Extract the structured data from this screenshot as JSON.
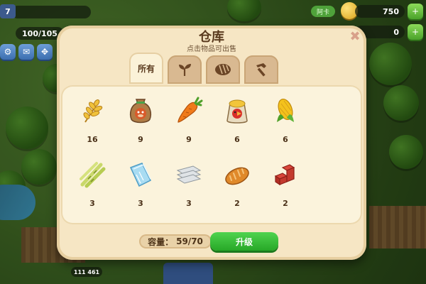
{
  "hud": {
    "level": "7",
    "xp": "100/105",
    "coins": "750",
    "premium": "0",
    "ribbon_label": "阿卡",
    "bottom_hint": "111 461"
  },
  "dialog": {
    "title": "仓库",
    "subtitle": "点击物品可出售",
    "close_symbol": "✖",
    "tabs": [
      {
        "id": "all",
        "label": "所有",
        "icon": "",
        "active": true
      },
      {
        "id": "crops",
        "label": "",
        "icon": "sprout-icon"
      },
      {
        "id": "products",
        "label": "",
        "icon": "bread-icon"
      },
      {
        "id": "materials",
        "label": "",
        "icon": "hammer-icon"
      }
    ],
    "items": [
      {
        "name": "wheat",
        "icon": "wheat-icon",
        "count": "16"
      },
      {
        "name": "feed-sack",
        "icon": "feed-sack-icon",
        "count": "9"
      },
      {
        "name": "carrot",
        "icon": "carrot-icon",
        "count": "9"
      },
      {
        "name": "chicken-feed",
        "icon": "chicken-feed-icon",
        "count": "6"
      },
      {
        "name": "corn",
        "icon": "corn-icon",
        "count": "6"
      },
      {
        "name": "sugarcane",
        "icon": "sugarcane-icon",
        "count": "3"
      },
      {
        "name": "glass",
        "icon": "glass-icon",
        "count": "3"
      },
      {
        "name": "nails",
        "icon": "nails-icon",
        "count": "3"
      },
      {
        "name": "bread",
        "icon": "bread-loaf-icon",
        "count": "2"
      },
      {
        "name": "bricks",
        "icon": "bricks-icon",
        "count": "2"
      }
    ],
    "capacity": {
      "label": "容量：",
      "value": "59/70"
    },
    "upgrade_label": "升级"
  }
}
